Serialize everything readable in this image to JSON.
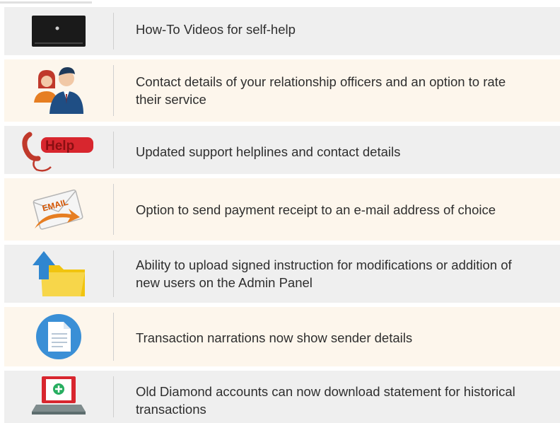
{
  "features": [
    {
      "icon": "video-player-icon",
      "text": "How-To Videos for self-help"
    },
    {
      "icon": "relationship-officers-icon",
      "text": "Contact details of your relationship officers and an option to rate their service"
    },
    {
      "icon": "help-telephone-icon",
      "text": "Updated support helplines and contact details",
      "icon_label": "Help"
    },
    {
      "icon": "email-envelope-icon",
      "text": "Option to send payment receipt to an e-mail address of choice",
      "icon_label": "EMAIL"
    },
    {
      "icon": "upload-folder-icon",
      "text": "Ability to upload signed instruction for modifications or addition of new users on the Admin Panel"
    },
    {
      "icon": "document-icon",
      "text": "Transaction narrations now show sender details"
    },
    {
      "icon": "laptop-download-icon",
      "text": "Old Diamond accounts can now download statement for historical transactions"
    }
  ],
  "colors": {
    "row_grey": "#efefef",
    "row_cream": "#fdf6ec",
    "accent_red": "#d8262e",
    "accent_blue": "#1e6fb8"
  }
}
